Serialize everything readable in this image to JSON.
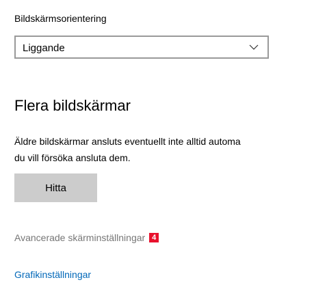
{
  "orientation": {
    "label": "Bildskärmsorientering",
    "selected_value": "Liggande",
    "chevron_icon": "chevron-down-icon"
  },
  "multiple_displays": {
    "heading": "Flera bildskärmar",
    "description_line1": "Äldre bildskärmar ansluts eventuellt inte alltid automa",
    "description_line2": "du vill försöka ansluta dem.",
    "detect_button_label": "Hitta"
  },
  "advanced_display": {
    "link_text": "Avancerade skärminställningar",
    "badge": "4",
    "badge_color": "#e8112d"
  },
  "graphics_settings": {
    "link_text": "Grafikinställningar",
    "link_color": "#0067b8"
  }
}
